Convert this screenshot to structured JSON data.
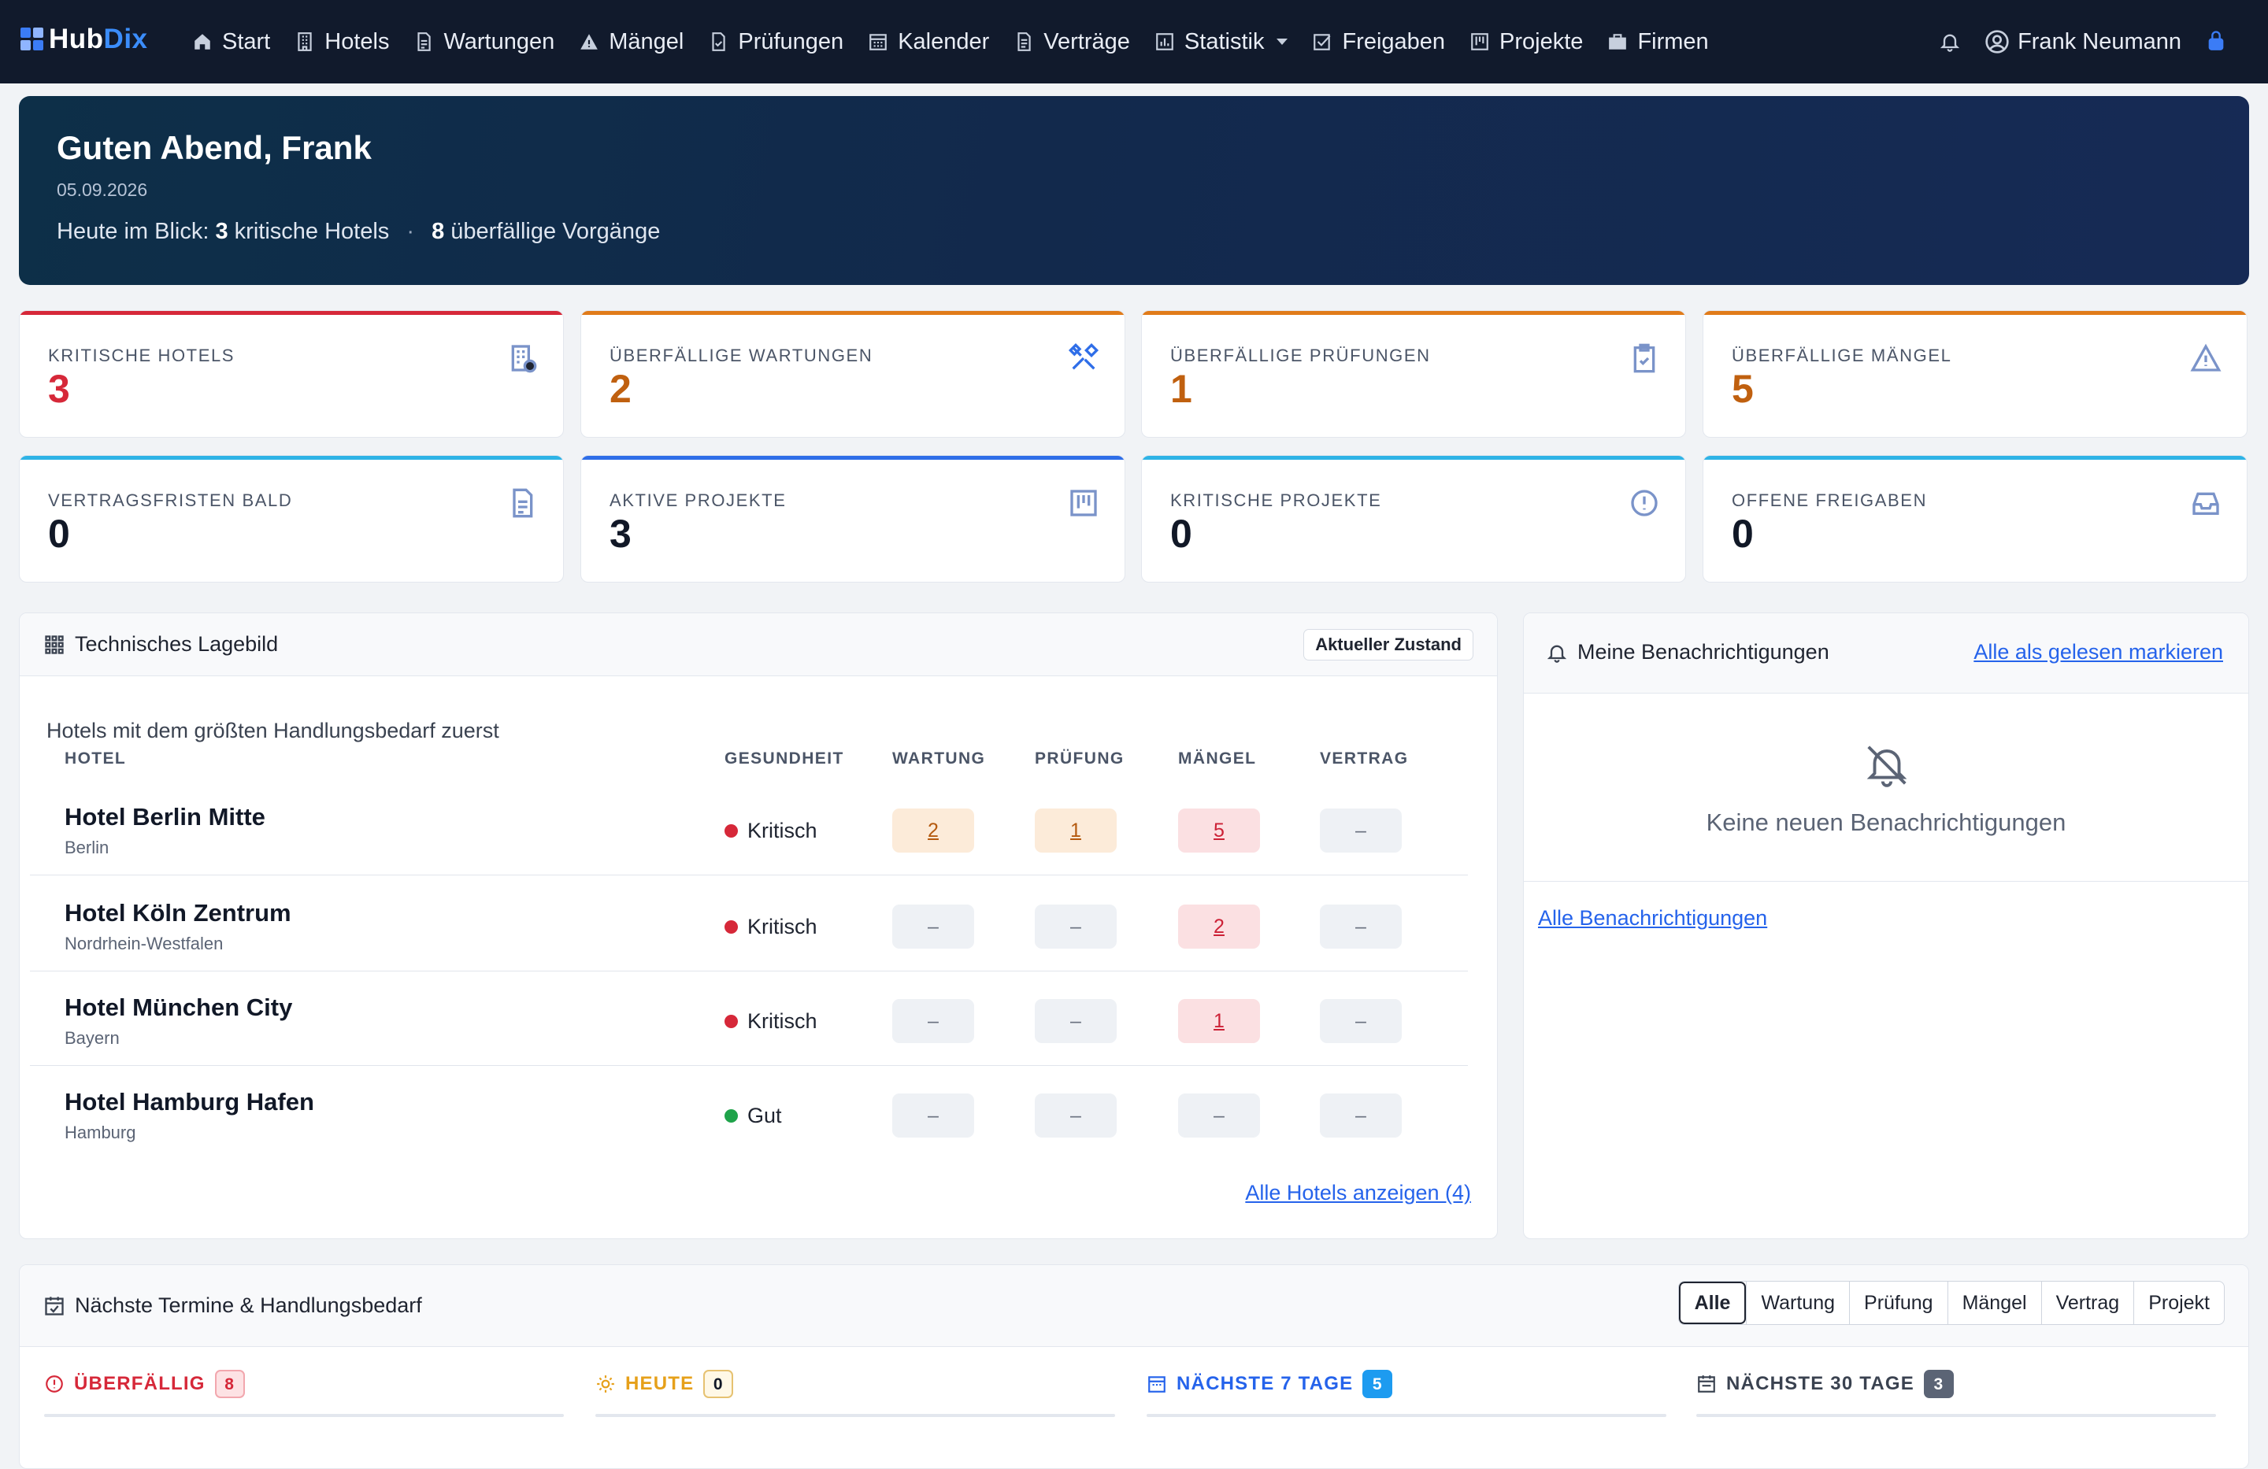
{
  "brand": {
    "prefix": "Hub",
    "suffix": "Dix"
  },
  "nav": [
    {
      "label": "Start",
      "icon": "home-icon"
    },
    {
      "label": "Hotels",
      "icon": "building-icon"
    },
    {
      "label": "Wartungen",
      "icon": "document-icon"
    },
    {
      "label": "Mängel",
      "icon": "warning-icon"
    },
    {
      "label": "Prüfungen",
      "icon": "file-check-icon"
    },
    {
      "label": "Kalender",
      "icon": "calendar-icon"
    },
    {
      "label": "Verträge",
      "icon": "contract-icon"
    },
    {
      "label": "Statistik",
      "icon": "chart-icon"
    },
    {
      "label": "Freigaben",
      "icon": "checkbox-icon"
    },
    {
      "label": "Projekte",
      "icon": "kanban-icon"
    },
    {
      "label": "Firmen",
      "icon": "briefcase-icon"
    }
  ],
  "user": {
    "name": "Frank Neumann"
  },
  "hero": {
    "greeting": "Guten Abend, Frank",
    "date": "05.09.2026",
    "prefix": "Heute im Blick:",
    "critical_count": "3",
    "critical_text": "kritische Hotels",
    "separator": "·",
    "overdue_count": "8",
    "overdue_text": "überfällige Vorgänge"
  },
  "kpis": [
    {
      "label": "Kritische Hotels",
      "value": "3",
      "bar": "#d62839",
      "color": "#d62839",
      "icon": "building-alert-icon",
      "icon_color": "#7a93c9"
    },
    {
      "label": "Überfällige Wartungen",
      "value": "2",
      "bar": "#e07b1a",
      "color": "#c0600f",
      "icon": "tools-icon",
      "icon_color": "#2f6ee8"
    },
    {
      "label": "Überfällige Prüfungen",
      "value": "1",
      "bar": "#e07b1a",
      "color": "#c0600f",
      "icon": "clipboard-check-icon",
      "icon_color": "#7a93c9"
    },
    {
      "label": "Überfällige Mängel",
      "value": "5",
      "bar": "#e07b1a",
      "color": "#c0600f",
      "icon": "warning-icon",
      "icon_color": "#7a93c9"
    },
    {
      "label": "Vertragsfristen bald",
      "value": "0",
      "bar": "#2fb3e6",
      "color": "#111827",
      "icon": "document-icon",
      "icon_color": "#7a93c9"
    },
    {
      "label": "Aktive Projekte",
      "value": "3",
      "bar": "#2f6ee8",
      "color": "#111827",
      "icon": "kanban-icon",
      "icon_color": "#7a93c9"
    },
    {
      "label": "Kritische Projekte",
      "value": "0",
      "bar": "#2fb3e6",
      "color": "#111827",
      "icon": "alert-circle-icon",
      "icon_color": "#7a93c9"
    },
    {
      "label": "Offene Freigaben",
      "value": "0",
      "bar": "#2fb3e6",
      "color": "#111827",
      "icon": "inbox-icon",
      "icon_color": "#7a93c9"
    }
  ],
  "lagebild": {
    "title": "Technisches Lagebild",
    "state_badge": "Aktueller Zustand",
    "subtitle": "Hotels mit dem größten Handlungsbedarf zuerst",
    "columns": [
      "Hotel",
      "Gesundheit",
      "Wartung",
      "Prüfung",
      "Mängel",
      "Vertrag"
    ],
    "rows": [
      {
        "name": "Hotel Berlin Mitte",
        "region": "Berlin",
        "health": "Kritisch",
        "health_color": "#d62839",
        "cells": [
          {
            "v": "2",
            "t": "warn"
          },
          {
            "v": "1",
            "t": "warn"
          },
          {
            "v": "5",
            "t": "bad"
          },
          {
            "v": "–",
            "t": "empty"
          }
        ]
      },
      {
        "name": "Hotel Köln Zentrum",
        "region": "Nordrhein-Westfalen",
        "health": "Kritisch",
        "health_color": "#d62839",
        "cells": [
          {
            "v": "–",
            "t": "empty"
          },
          {
            "v": "–",
            "t": "empty"
          },
          {
            "v": "2",
            "t": "bad"
          },
          {
            "v": "–",
            "t": "empty"
          }
        ]
      },
      {
        "name": "Hotel München City",
        "region": "Bayern",
        "health": "Kritisch",
        "health_color": "#d62839",
        "cells": [
          {
            "v": "–",
            "t": "empty"
          },
          {
            "v": "–",
            "t": "empty"
          },
          {
            "v": "1",
            "t": "bad"
          },
          {
            "v": "–",
            "t": "empty"
          }
        ]
      },
      {
        "name": "Hotel Hamburg Hafen",
        "region": "Hamburg",
        "health": "Gut",
        "health_color": "#1fa34a",
        "cells": [
          {
            "v": "–",
            "t": "empty"
          },
          {
            "v": "–",
            "t": "empty"
          },
          {
            "v": "–",
            "t": "empty"
          },
          {
            "v": "–",
            "t": "empty"
          }
        ]
      }
    ],
    "all_link": "Alle Hotels anzeigen (4)"
  },
  "notifications": {
    "title": "Meine Benachrichtigungen",
    "mark_all": "Alle als gelesen markieren",
    "empty_text": "Keine neuen Benachrichtigungen",
    "all_link": "Alle Benachrichtigungen"
  },
  "termine": {
    "title": "Nächste Termine & Handlungsbedarf",
    "filters": [
      "Alle",
      "Wartung",
      "Prüfung",
      "Mängel",
      "Vertrag",
      "Projekt"
    ],
    "active_filter": "Alle",
    "columns": [
      {
        "label": "Überfällig",
        "count": "8",
        "color": "#d62839",
        "badge_bg": "#fde2e4",
        "badge_border": "#f2a7ae",
        "badge_color": "#d62839",
        "icon": "alert-circle-icon"
      },
      {
        "label": "Heute",
        "count": "0",
        "color": "#e6a01a",
        "badge_bg": "#fff8e6",
        "badge_border": "#e6c271",
        "badge_color": "#111827",
        "icon": "sun-icon"
      },
      {
        "label": "Nächste 7 Tage",
        "count": "5",
        "color": "#2563eb",
        "badge_bg": "#1d9bf0",
        "badge_border": "#1d9bf0",
        "badge_color": "#ffffff",
        "icon": "calendar-icon"
      },
      {
        "label": "Nächste 30 Tage",
        "count": "3",
        "color": "#3a4250",
        "badge_bg": "#5b6475",
        "badge_border": "#5b6475",
        "badge_color": "#ffffff",
        "icon": "calendar-month-icon"
      }
    ]
  }
}
